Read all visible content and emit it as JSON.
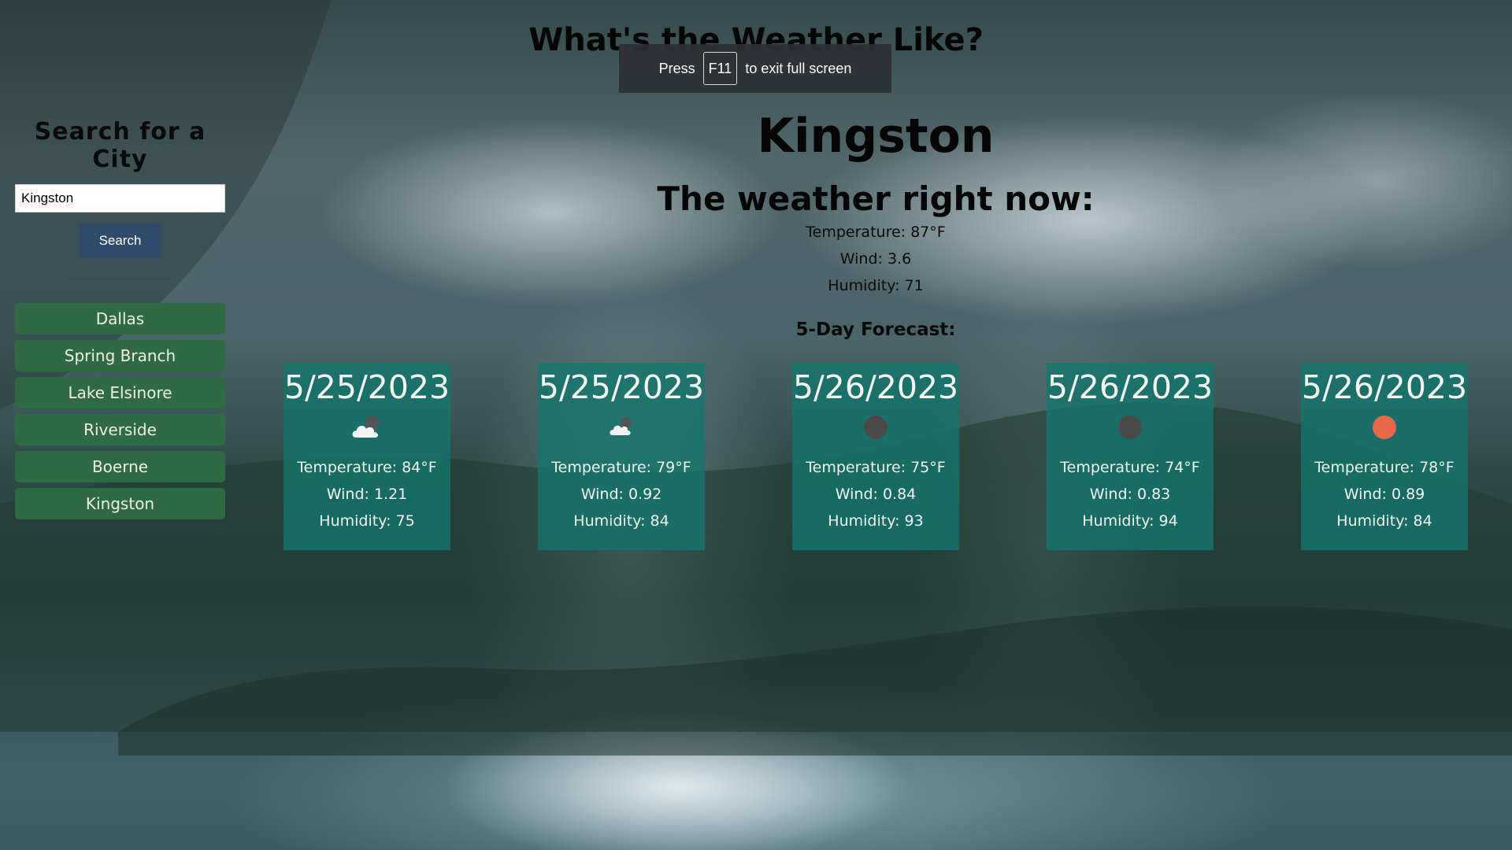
{
  "header": {
    "title": "What's the Weather Like?"
  },
  "fullscreen_notice": {
    "before": "Press",
    "key": "F11",
    "after": "to exit full screen"
  },
  "sidebar": {
    "title": "Search for a City",
    "search_value": "Kingston",
    "search_button": "Search",
    "history": [
      "Dallas",
      "Spring Branch",
      "Lake Elsinore",
      "Riverside",
      "Boerne",
      "Kingston"
    ]
  },
  "current": {
    "city": "Kingston",
    "heading": "The weather right now:",
    "temperature": "Temperature: 87°F",
    "wind": "Wind: 3.6",
    "humidity": "Humidity: 71"
  },
  "forecast": {
    "heading": "5-Day Forecast:",
    "days": [
      {
        "date": "5/25/2023",
        "icon": "few-clouds-night-icon",
        "temperature": "Temperature: 84°F",
        "wind": "Wind: 1.21",
        "humidity": "Humidity: 75"
      },
      {
        "date": "5/25/2023",
        "icon": "scattered-clouds-night-icon",
        "temperature": "Temperature: 79°F",
        "wind": "Wind: 0.92",
        "humidity": "Humidity: 84"
      },
      {
        "date": "5/26/2023",
        "icon": "clear-night-icon",
        "temperature": "Temperature: 75°F",
        "wind": "Wind: 0.84",
        "humidity": "Humidity: 93"
      },
      {
        "date": "5/26/2023",
        "icon": "clear-night-icon",
        "temperature": "Temperature: 74°F",
        "wind": "Wind: 0.83",
        "humidity": "Humidity: 94"
      },
      {
        "date": "5/26/2023",
        "icon": "clear-day-sun-icon",
        "temperature": "Temperature: 78°F",
        "wind": "Wind: 0.89",
        "humidity": "Humidity: 84"
      }
    ]
  },
  "colors": {
    "history_button": "#2e6a42",
    "search_button": "#2f4c6a",
    "card_background": "#14766e",
    "sun_icon": "#e8694a",
    "moon_icon": "#4a4a4a"
  }
}
